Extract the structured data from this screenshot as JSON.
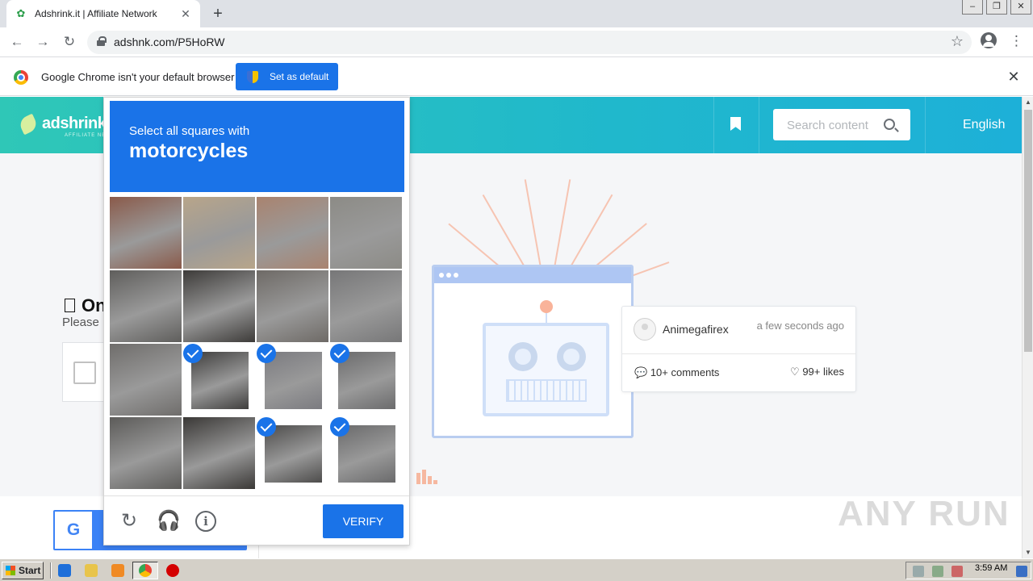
{
  "browser": {
    "tab": {
      "title": "Adshrink.it | Affiliate Network"
    },
    "url": "adshnk.com/P5HoRW",
    "infobar": {
      "message": "Google Chrome isn't your default browser",
      "button": "Set as default"
    }
  },
  "site": {
    "logo": "adshrink.it",
    "logo_sub": "AFFILIATE NETWORK",
    "search_placeholder": "Search content",
    "language": "English",
    "left_heading": "On",
    "left_sub": "Please",
    "comment": {
      "user": "Animegafirex",
      "time": "a few seconds ago",
      "comments": "10+ comments",
      "likes": "99+ likes"
    }
  },
  "captcha": {
    "instruction": "Select all squares with",
    "target": "motorcycles",
    "verify": "VERIFY",
    "tiles_selected": [
      false,
      false,
      false,
      false,
      false,
      false,
      false,
      false,
      false,
      true,
      true,
      true,
      false,
      false,
      true,
      true
    ]
  },
  "watermark": "ANY RUN",
  "taskbar": {
    "start": "Start",
    "clock": "3:59 AM"
  },
  "colors": {
    "accent": "#1a73e8",
    "header_start": "#2fc7b7",
    "header_end": "#1db0d8"
  }
}
